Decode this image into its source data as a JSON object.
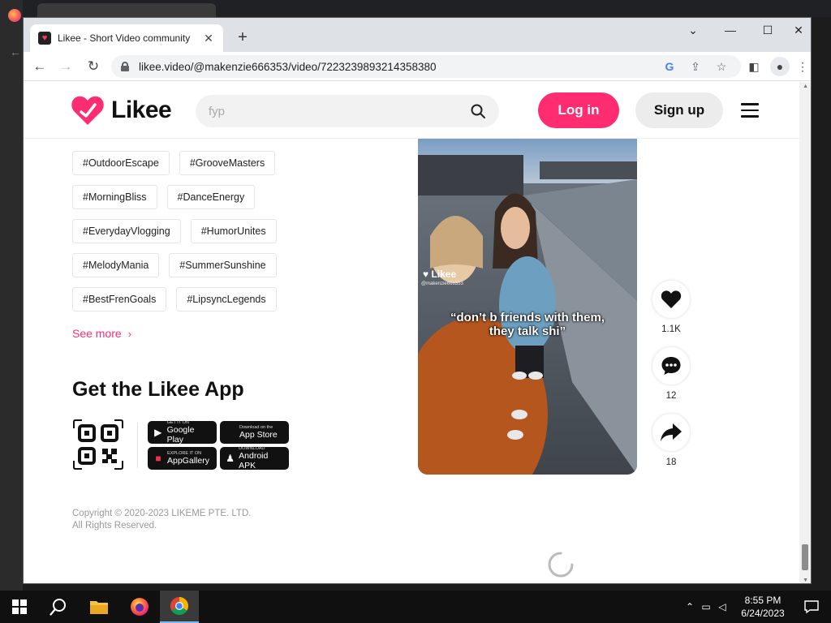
{
  "browser": {
    "tab_title": "Likee - Short Video community",
    "url": "likee.video/@makenzie666353/video/7223239893214358380",
    "new_tab_symbol": "+",
    "tab_close_symbol": "✕"
  },
  "header": {
    "logo_text": "Likee",
    "search_placeholder": "fyp",
    "login_label": "Log in",
    "signup_label": "Sign up"
  },
  "tags": [
    [
      "#OutdoorEscape",
      "#GrooveMasters"
    ],
    [
      "#MorningBliss",
      "#DanceEnergy"
    ],
    [
      "#EverydayVlogging",
      "#HumorUnites"
    ],
    [
      "#MelodyMania",
      "#SummerSunshine"
    ],
    [
      "#BestFrenGoals",
      "#LipsyncLegends"
    ]
  ],
  "see_more": "See more",
  "app_section": {
    "title": "Get the Likee App",
    "stores": [
      {
        "small": "GET IT ON",
        "big": "Google Play",
        "icon": "google-play-icon"
      },
      {
        "small": "Download on the",
        "big": "App Store",
        "icon": "apple-icon"
      },
      {
        "small": "EXPLORE IT ON",
        "big": "AppGallery",
        "icon": "huawei-icon"
      },
      {
        "small": "DOWNLOAD",
        "big": "Android APK",
        "icon": "android-icon"
      }
    ]
  },
  "copyright": {
    "line1": "Copyright © 2020-2023 LIKEME PTE. LTD.",
    "line2": "All Rights Reserved."
  },
  "video": {
    "watermark": "Likee",
    "watermark_user": "@makenzie666353",
    "caption_line1": "“don’t b friends with them,",
    "caption_line2": "they talk shi”"
  },
  "actions": {
    "likes": "1.1K",
    "comments": "12",
    "shares": "18"
  },
  "taskbar": {
    "time": "8:55 PM",
    "date": "6/24/2023"
  },
  "colors": {
    "brand": "#ff2c72",
    "dark": "#111111"
  }
}
